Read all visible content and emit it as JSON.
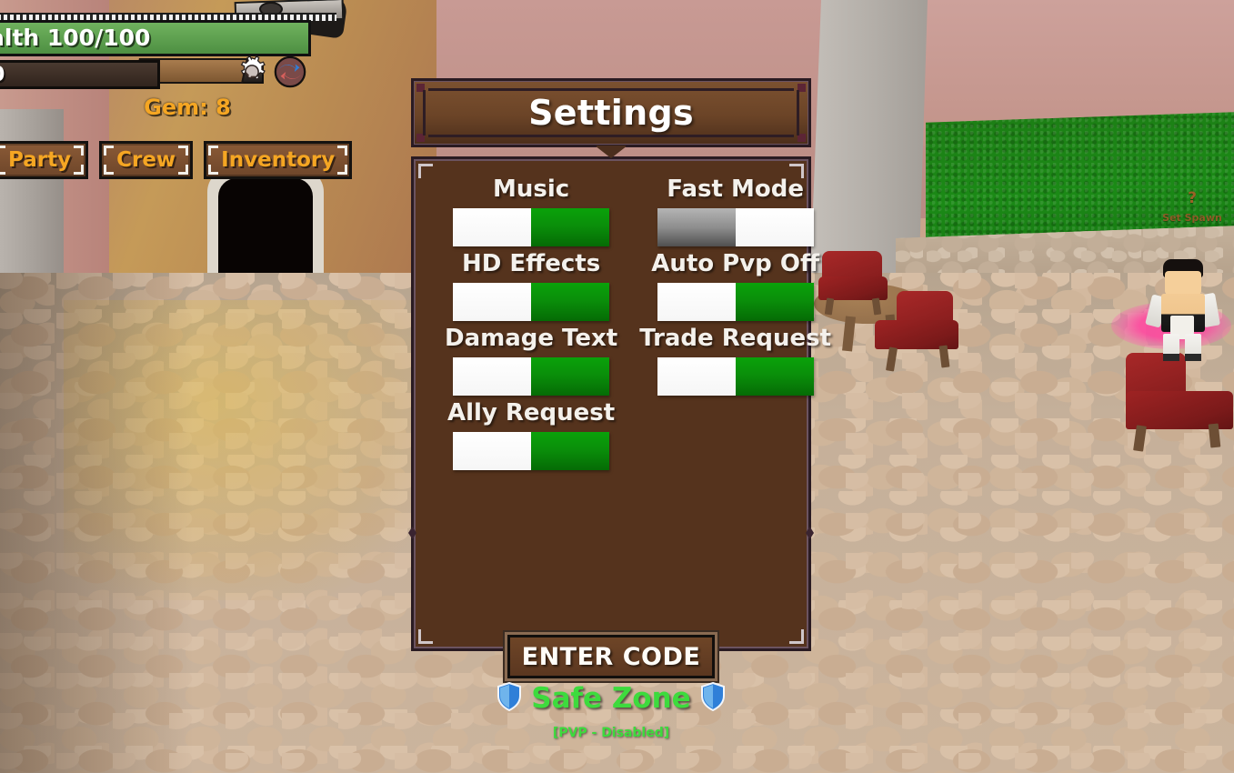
{
  "hud": {
    "health_text": "alth 100/100",
    "secondary_text": "0",
    "gem_label": "Gem: 8",
    "gear_icon": "gear-icon",
    "swap_icon": "swap-icon",
    "nav_buttons": [
      {
        "label": "Party"
      },
      {
        "label": "Crew"
      },
      {
        "label": "Inventory"
      }
    ]
  },
  "world": {
    "nametag_question": "?",
    "nametag_label": "Set Spawn"
  },
  "settings": {
    "title": "Settings",
    "options": [
      {
        "label": "Music",
        "state": "on",
        "state_color": "#0a8f0a"
      },
      {
        "label": "Fast Mode",
        "state": "off",
        "state_color": "#8e8e8e"
      },
      {
        "label": "HD Effects",
        "state": "on",
        "state_color": "#0a8f0a"
      },
      {
        "label": "Auto Pvp Off",
        "state": "on",
        "state_color": "#0a8f0a"
      },
      {
        "label": "Damage Text",
        "state": "on",
        "state_color": "#0a8f0a"
      },
      {
        "label": "Trade Request",
        "state": "on",
        "state_color": "#0a8f0a"
      },
      {
        "label": "Ally Request",
        "state": "on",
        "state_color": "#0a8f0a"
      }
    ],
    "enter_code_label": "ENTER CODE"
  },
  "status": {
    "safe_zone_label": "Safe Zone",
    "pvp_label": "[PVP - Disabled]",
    "safe_zone_color": "#3ddb3d",
    "shield_icon": "shield-icon"
  },
  "theme": {
    "panel_bg": "#55331d",
    "panel_border": "#2a1b22",
    "accent_orange": "#f5a623",
    "toggle_on": "#0a8f0a",
    "toggle_off": "#8e8e8e"
  }
}
